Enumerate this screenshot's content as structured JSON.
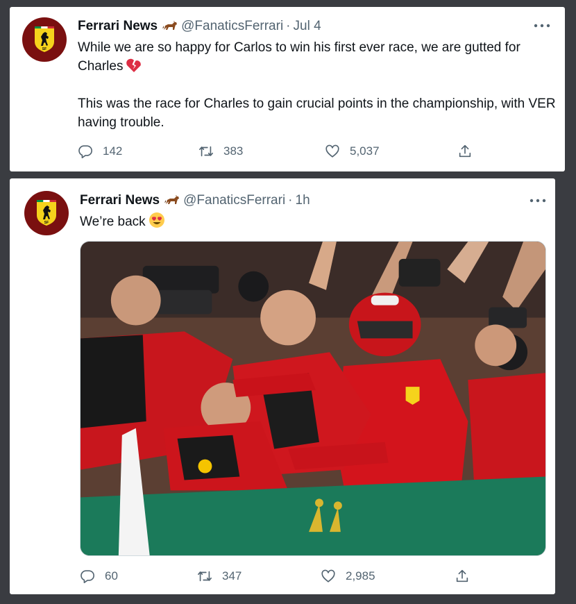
{
  "tweets": [
    {
      "author": {
        "name": "Ferrari News",
        "handle": "@FanaticsFerrari"
      },
      "separator": "·",
      "time": "Jul 4",
      "paragraphs": [
        "While we are so happy for Carlos to win his first ever race, we are gutted for Charles",
        "This was the race for Charles to gain crucial points in the championship, with VER having trouble."
      ],
      "emoji": "broken-heart",
      "stats": {
        "replies": "142",
        "retweets": "383",
        "likes": "5,037"
      }
    },
    {
      "author": {
        "name": "Ferrari News",
        "handle": "@FanaticsFerrari"
      },
      "separator": "·",
      "time": "1h",
      "paragraphs": [
        "We’re back"
      ],
      "emoji": "heart-eyes",
      "has_photo": true,
      "stats": {
        "replies": "60",
        "retweets": "347",
        "likes": "2,985"
      }
    }
  ],
  "icons": {
    "avatar": "ferrari-shield-icon",
    "author_badge": "horse-icon",
    "more": "more-icon",
    "reply": "reply-icon",
    "retweet": "retweet-icon",
    "like": "like-icon",
    "share": "share-icon"
  },
  "colors": {
    "background": "#3a3c41",
    "card": "#ffffff",
    "text": "#0f1419",
    "muted": "#536471",
    "avatar_red": "#7a1010",
    "shield_yellow": "#f5d31c"
  }
}
